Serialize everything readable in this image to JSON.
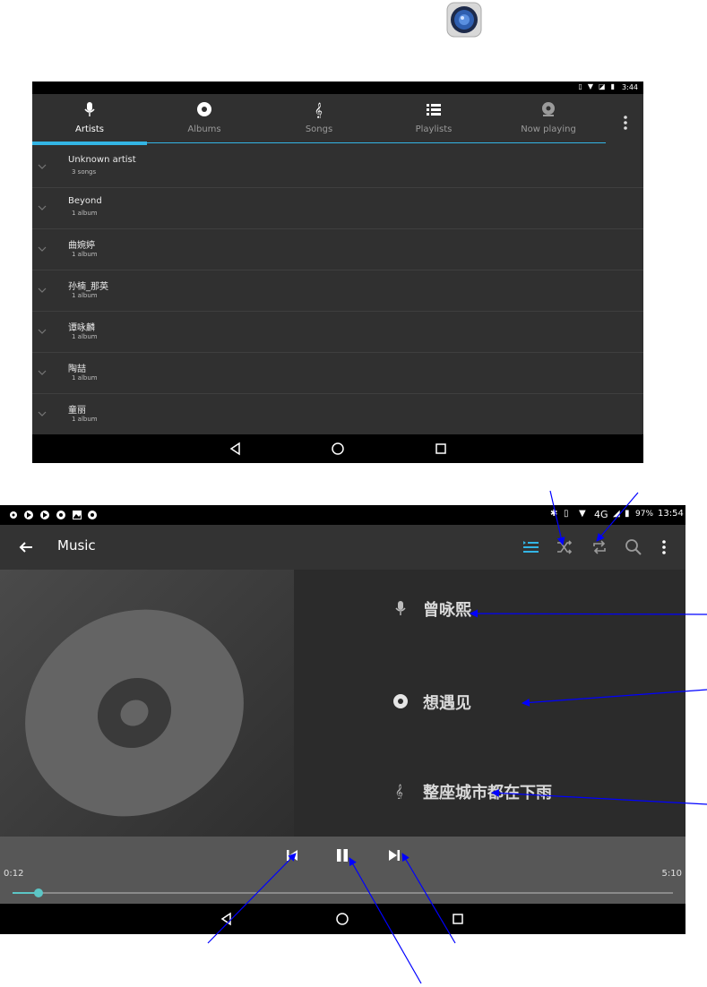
{
  "app": {
    "speaker_icon": "speaker-icon"
  },
  "library": {
    "status": {
      "time": "3:44"
    },
    "tabs": [
      {
        "label": "Artists",
        "icon": "microphone-icon",
        "active": true
      },
      {
        "label": "Albums",
        "icon": "disc-icon",
        "active": false
      },
      {
        "label": "Songs",
        "icon": "treble-clef-icon",
        "active": false
      },
      {
        "label": "Playlists",
        "icon": "list-icon",
        "active": false
      },
      {
        "label": "Now playing",
        "icon": "now-playing-icon",
        "active": false
      }
    ],
    "artists": [
      {
        "name": "Unknown artist",
        "count": "3 songs"
      },
      {
        "name": "Beyond",
        "count": "1 album"
      },
      {
        "name": "曲婉婷",
        "count": "1 album"
      },
      {
        "name": "孙楠_那英",
        "count": "1 album"
      },
      {
        "name": "谭咏麟",
        "count": "1 album"
      },
      {
        "name": "陶喆",
        "count": "1 album"
      },
      {
        "name": "童丽",
        "count": "1 album"
      }
    ]
  },
  "player": {
    "status": {
      "network": "4G",
      "battery": "97%",
      "time": "13:54"
    },
    "title": "Music",
    "artist": "曾咏熙",
    "album": "想遇见",
    "song": "整座城市都在下雨",
    "elapsed": "0:12",
    "total": "5:10",
    "progress_fraction": 0.04,
    "colors": {
      "accent": "#33b5e5",
      "seek": "#5cc6c6",
      "annotation": "#0000ff"
    }
  }
}
